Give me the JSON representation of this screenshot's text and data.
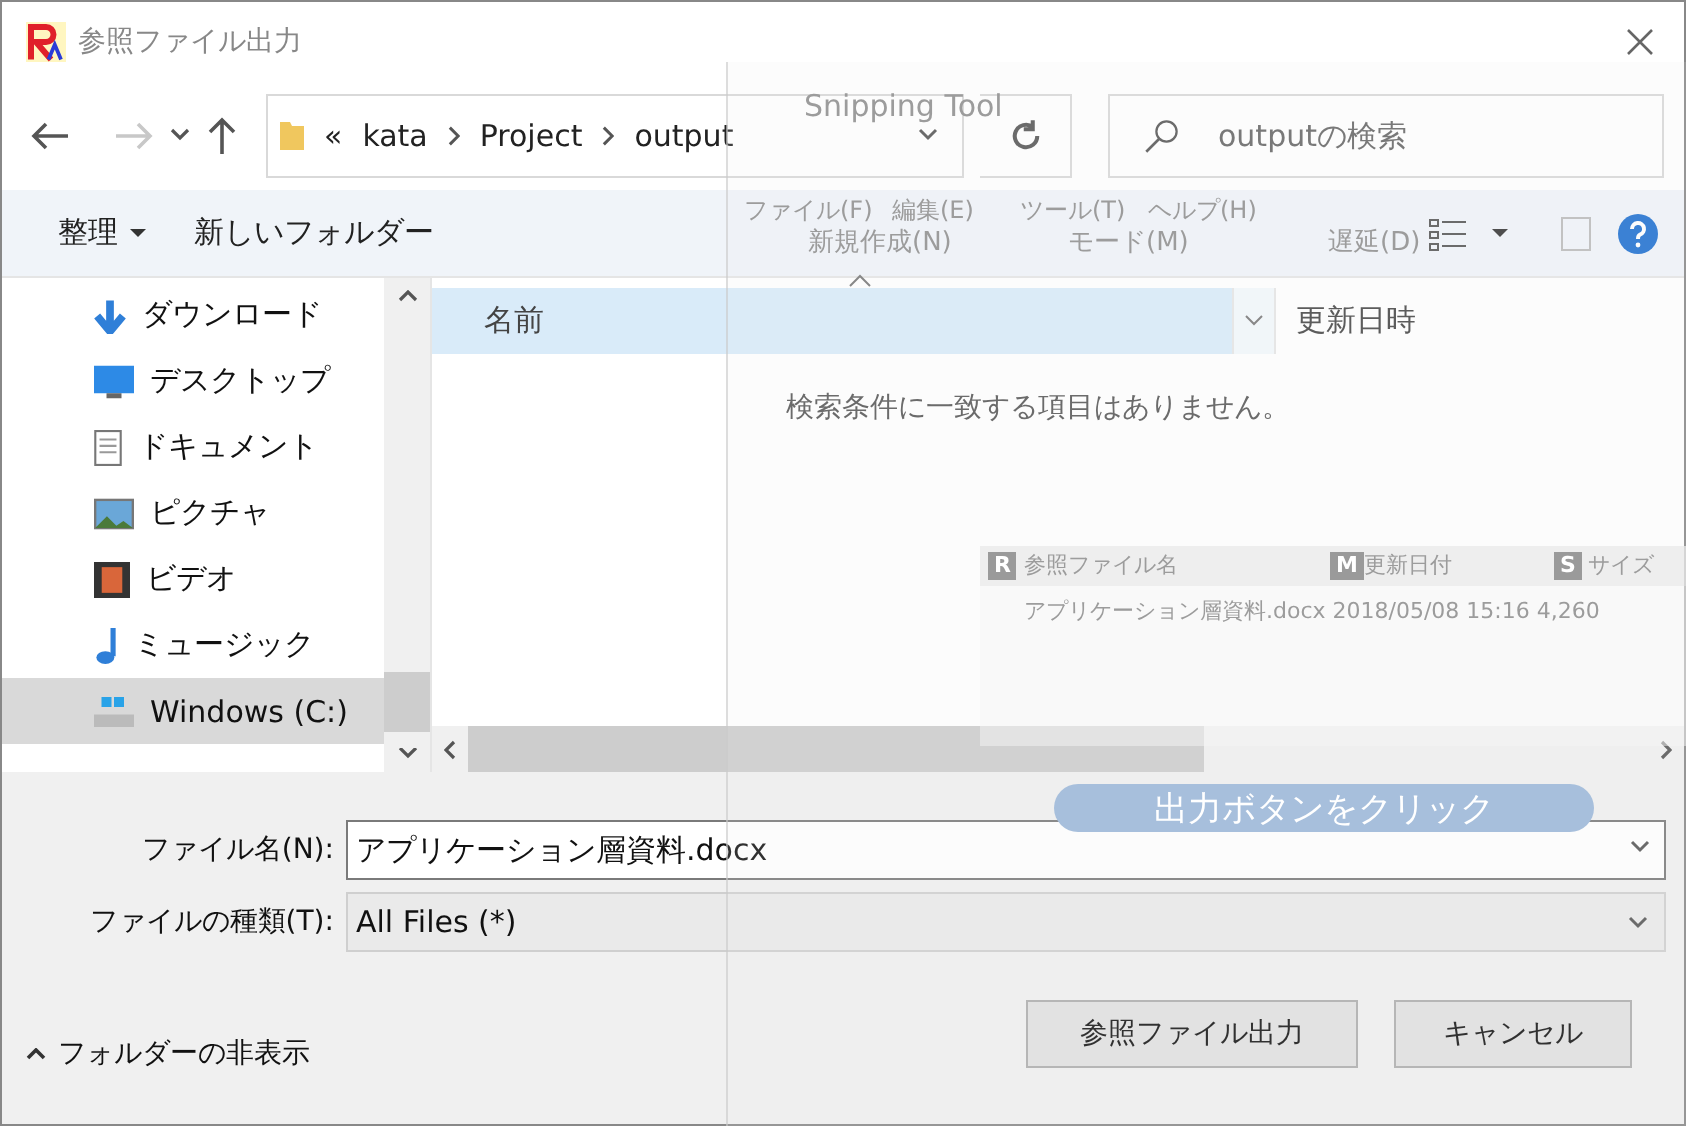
{
  "window": {
    "title": "参照ファイル出力"
  },
  "nav": {
    "breadcrumb_prefix": "«",
    "path": [
      "kata",
      "Project",
      "output"
    ],
    "search": {
      "placeholder": "outputの検索"
    }
  },
  "toolbar": {
    "organize": "整理",
    "new_folder": "新しいフォルダー"
  },
  "sidebar": {
    "items": [
      {
        "label": "ダウンロード",
        "kind": "download",
        "selected": false
      },
      {
        "label": "デスクトップ",
        "kind": "desktop",
        "selected": false
      },
      {
        "label": "ドキュメント",
        "kind": "document",
        "selected": false
      },
      {
        "label": "ピクチャ",
        "kind": "picture",
        "selected": false
      },
      {
        "label": "ビデオ",
        "kind": "video",
        "selected": false
      },
      {
        "label": "ミュージック",
        "kind": "music",
        "selected": false
      },
      {
        "label": "Windows (C:)",
        "kind": "drive",
        "selected": true
      }
    ]
  },
  "file_list": {
    "columns": [
      {
        "label": "名前",
        "sorted": true
      },
      {
        "label": "更新日時",
        "sorted": false
      }
    ],
    "empty_message": "検索条件に一致する項目はありません。"
  },
  "form": {
    "file_name": {
      "label": "ファイル名(N):",
      "value": "アプリケーション層資料.docx"
    },
    "file_type": {
      "label": "ファイルの種類(T):",
      "value": "All Files (*)"
    }
  },
  "footer": {
    "hide_folders": "フォルダーの非表示",
    "buttons": [
      "参照ファイル出力",
      "キャンセル"
    ]
  },
  "background_window": {
    "title": "Snipping Tool",
    "menu": [
      "ファイル(F)",
      "編集(E)",
      "ツール(T)",
      "ヘルプ(H)"
    ],
    "tools": [
      "新規作成(N)",
      "モード(M)",
      "遅延(D)"
    ],
    "table": {
      "columns": [
        {
          "badge": "R",
          "label": "参照ファイル名"
        },
        {
          "badge": "M",
          "label": "更新日付"
        },
        {
          "badge": "S",
          "label": "サイズ"
        }
      ],
      "row": "アプリケーション層資料.docx 2018/05/08 15:16 4,260"
    },
    "action": "出力ボタンをクリック"
  }
}
